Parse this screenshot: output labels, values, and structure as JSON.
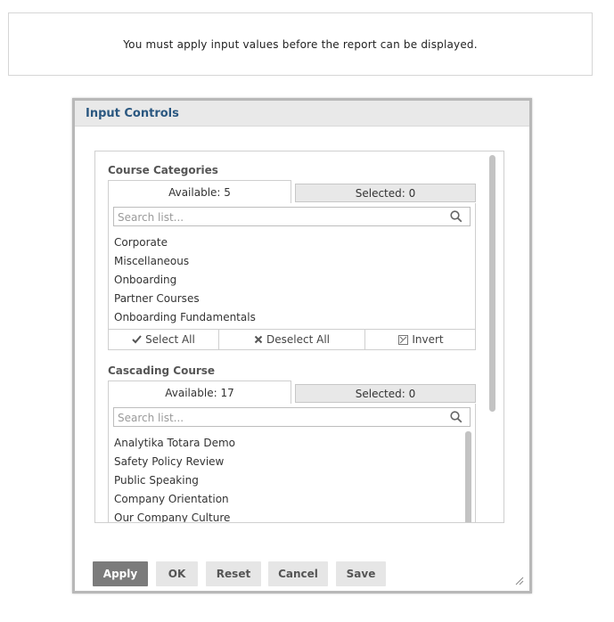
{
  "notice": {
    "text": "You must apply input values before the report can be displayed."
  },
  "dialog": {
    "title": "Input Controls",
    "course_categories": {
      "title": "Course Categories",
      "tab_available": "Available: 5",
      "tab_selected": "Selected: 0",
      "search_placeholder": "Search list...",
      "items": [
        "Corporate",
        "Miscellaneous",
        "Onboarding",
        "Partner Courses",
        "Onboarding Fundamentals"
      ],
      "actions": {
        "select_all": "Select All",
        "deselect_all": "Deselect All",
        "invert": "Invert"
      }
    },
    "cascading_course": {
      "title": "Cascading Course",
      "tab_available": "Available: 17",
      "tab_selected": "Selected: 0",
      "search_placeholder": "Search list...",
      "items": [
        "Analytika Totara Demo",
        "Safety Policy Review",
        "Public Speaking",
        "Company Orientation",
        "Our Company Culture"
      ]
    },
    "buttons": {
      "apply": "Apply",
      "ok": "OK",
      "reset": "Reset",
      "cancel": "Cancel",
      "save": "Save"
    }
  }
}
